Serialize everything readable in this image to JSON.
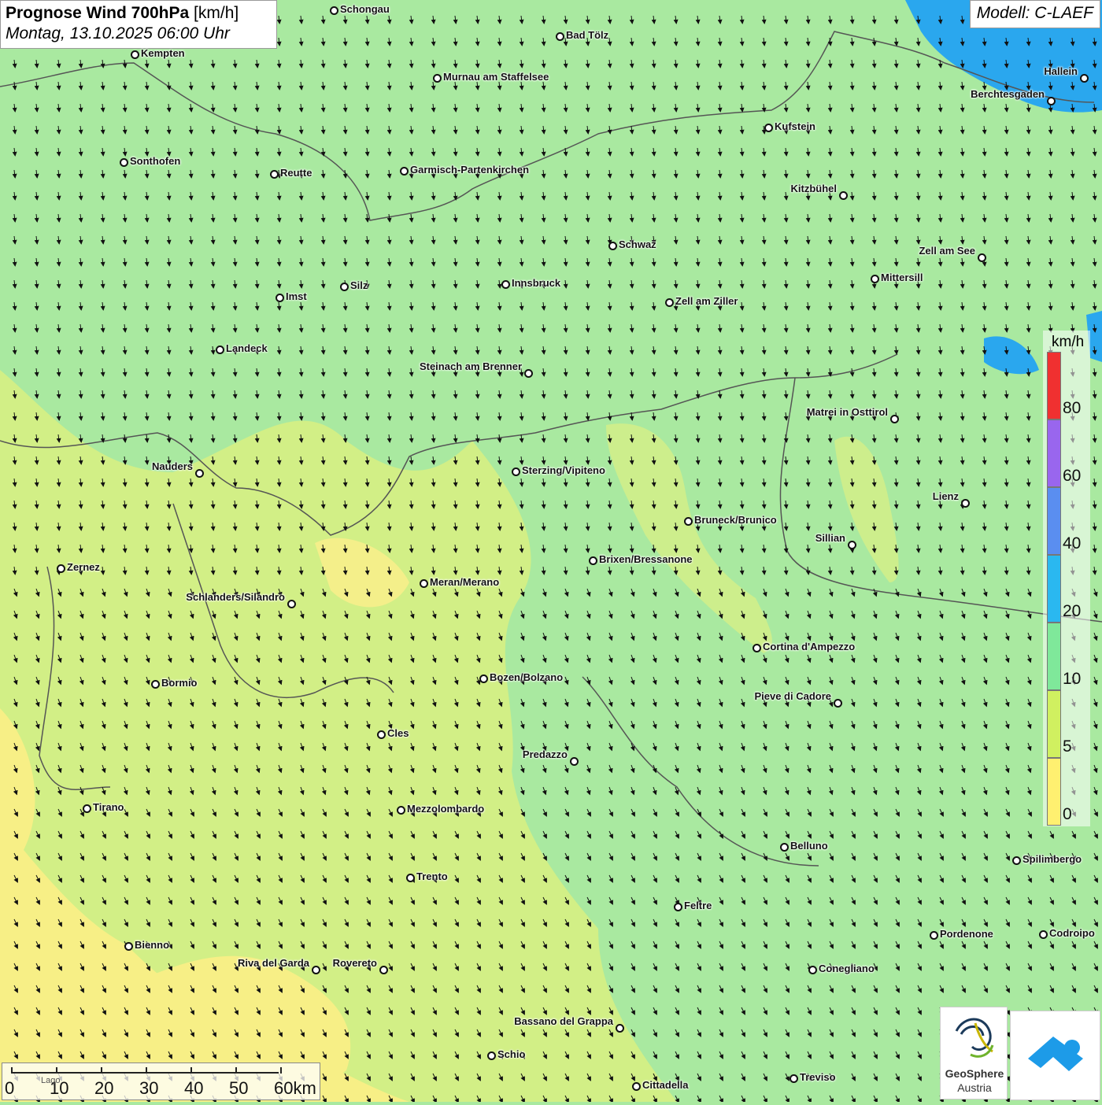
{
  "header": {
    "title": "Prognose Wind 700hPa",
    "unit": "[km/h]",
    "datetime": "Montag, 13.10.2025 06:00 Uhr",
    "model": "Modell: C-LAEF"
  },
  "colors": {
    "calm": "#fff07a",
    "light": "#d8f07a",
    "moderate": "#a9e9a0",
    "water": "#2aa7ee",
    "border": "#555555"
  },
  "cities": [
    {
      "name": "Schongau"
    },
    {
      "name": "Bad Tölz"
    },
    {
      "name": "Kempten"
    },
    {
      "name": "Murnau am Staffelsee"
    },
    {
      "name": "Hallein"
    },
    {
      "name": "Berchtesgaden"
    },
    {
      "name": "Kufstein"
    },
    {
      "name": "Sonthofen"
    },
    {
      "name": "Reutte"
    },
    {
      "name": "Garmisch-Partenkirchen"
    },
    {
      "name": "Kitzbühel"
    },
    {
      "name": "Schwaz"
    },
    {
      "name": "Zell am See"
    },
    {
      "name": "Mittersill"
    },
    {
      "name": "Imst"
    },
    {
      "name": "Silz"
    },
    {
      "name": "Innsbruck"
    },
    {
      "name": "Zell am Ziller"
    },
    {
      "name": "Landeck"
    },
    {
      "name": "Steinach am Brenner"
    },
    {
      "name": "Matrei in Osttirol"
    },
    {
      "name": "Nauders"
    },
    {
      "name": "Sterzing/Vipiteno"
    },
    {
      "name": "Lienz"
    },
    {
      "name": "Bruneck/Brunico"
    },
    {
      "name": "Sillian"
    },
    {
      "name": "Zernez"
    },
    {
      "name": "Brixen/Bressanone"
    },
    {
      "name": "Meran/Merano"
    },
    {
      "name": "Schlanders/Silandro"
    },
    {
      "name": "Cortina d'Ampezzo"
    },
    {
      "name": "Bozen/Bolzano"
    },
    {
      "name": "Bormio"
    },
    {
      "name": "Pieve di Cadore"
    },
    {
      "name": "Cles"
    },
    {
      "name": "Predazzo"
    },
    {
      "name": "Tirano"
    },
    {
      "name": "Mezzolombardo"
    },
    {
      "name": "Belluno"
    },
    {
      "name": "Spilimbergo"
    },
    {
      "name": "Trento"
    },
    {
      "name": "Feltre"
    },
    {
      "name": "Bienno"
    },
    {
      "name": "Pordenone"
    },
    {
      "name": "Codroipo"
    },
    {
      "name": "Riva del Garda"
    },
    {
      "name": "Rovereto"
    },
    {
      "name": "Conegliano"
    },
    {
      "name": "Bassano del Grappa"
    },
    {
      "name": "Schio"
    },
    {
      "name": "Treviso"
    },
    {
      "name": "Cittadella"
    }
  ],
  "legend": {
    "unit": "km/h",
    "classes": [
      {
        "label": "80",
        "color": "#f03030"
      },
      {
        "label": "60",
        "color": "#9966ee"
      },
      {
        "label": "40",
        "color": "#5a8ef0"
      },
      {
        "label": "20",
        "color": "#2ab8f0"
      },
      {
        "label": "10",
        "color": "#7fe89a"
      },
      {
        "label": "5",
        "color": "#d0f060"
      },
      {
        "label": "0",
        "color": "#fff070"
      }
    ],
    "top_color": "#f03030"
  },
  "scalebar": {
    "labels": [
      "0",
      "10",
      "20",
      "30",
      "40",
      "50",
      "60km"
    ],
    "small_label": "Lago"
  },
  "logos": {
    "geosphere_name": "GeoSphere",
    "geosphere_sub": "Austria"
  }
}
